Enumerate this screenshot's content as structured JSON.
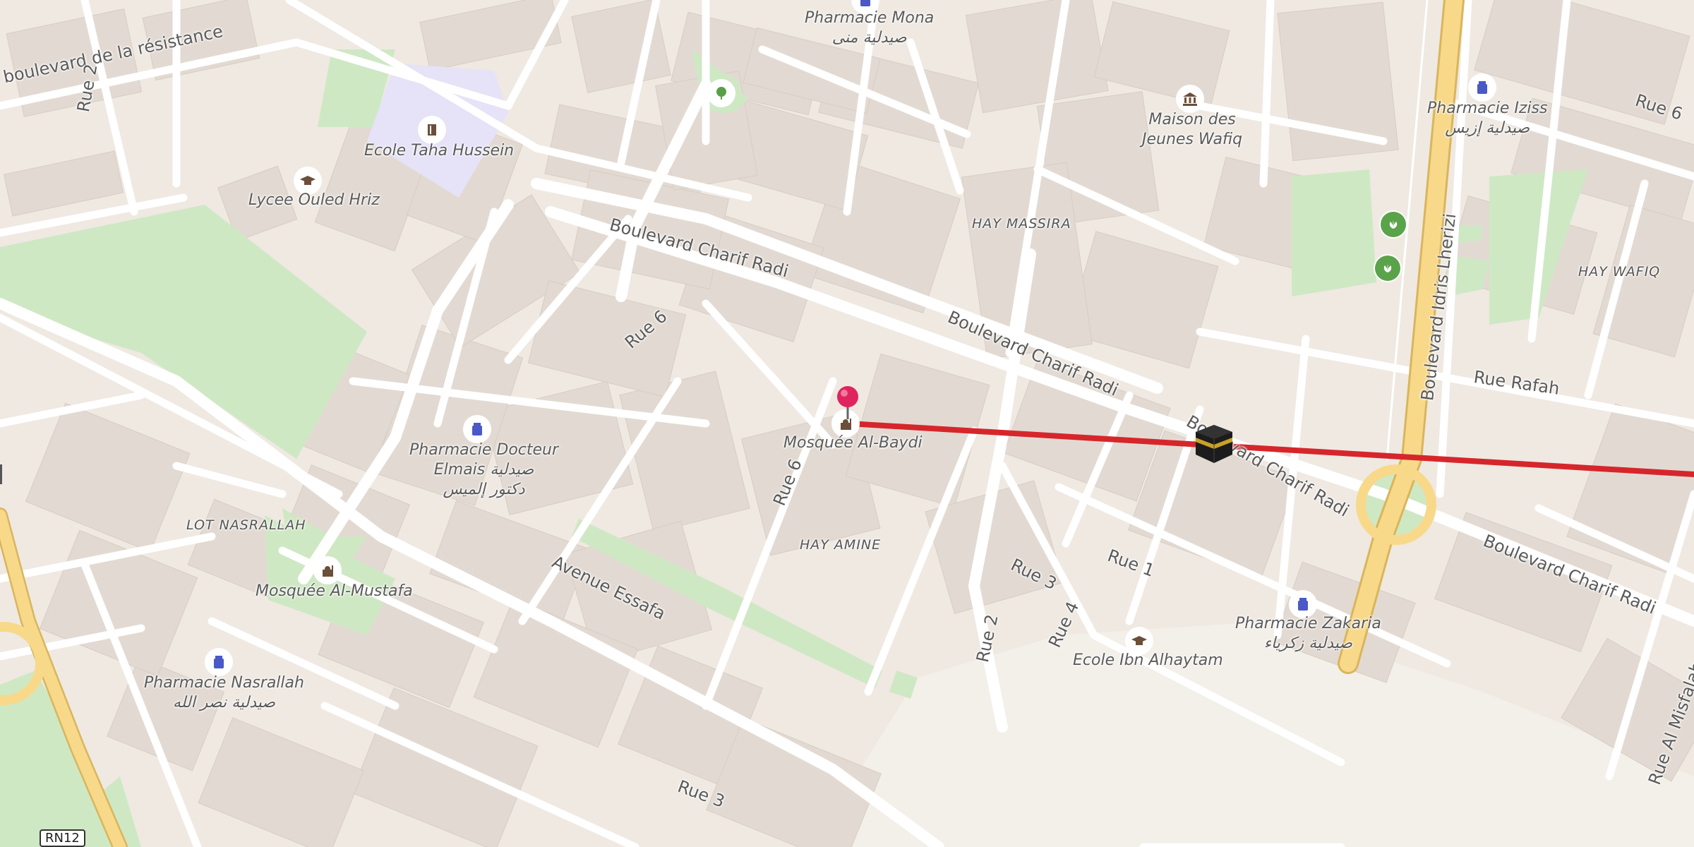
{
  "colors": {
    "land": "#efe9e2",
    "block": "#e2dad2",
    "road": "#ffffff",
    "major_road": "#f8d98a",
    "green": "#cfe8c4",
    "school": "#e6e2f7",
    "route_line": "#d6262b",
    "pin": "#e0245e",
    "pharmacy_icon": "#4a59c7",
    "amenity_icon": "#6b4f3a"
  },
  "areas": {
    "hay_massira": "HAY MASSIRA",
    "hay_wafiq": "HAY WAFIQ",
    "hay_amine": "HAY AMINE",
    "lot_nasrallah": "LOT NASRALLAH"
  },
  "streets": {
    "boulevard_resistance": "boulevard de la résistance",
    "rue_2_north": "Rue 2",
    "charif_radi_1": "Boulevard Charif Radi",
    "charif_radi_2": "Boulevard Charif Radi",
    "charif_radi_3": "Boulevard Charif Radi",
    "charif_radi_4": "Boulevard Charif Radi",
    "rue_6_north": "Rue 6",
    "rue_6_mid": "Rue 6",
    "rue_6_east": "Rue 6",
    "idris_lherizi": "Boulevard Idris Lherizi",
    "rue_rafah": "Rue Rafah",
    "avenue_essafa": "Avenue Essafa",
    "rue_1": "Rue 1",
    "rue_2_south": "Rue 2",
    "rue_3_a": "Rue 3",
    "rue_3_b": "Rue 3",
    "rue_4": "Rue 4",
    "rue_al_misfalah": "Rue Al Misfalah",
    "route_badge": "RN12"
  },
  "pois": {
    "pharmacie_mona": {
      "name": "Pharmacie Mona",
      "name_ar": "صيدلية منى",
      "icon": "pharmacy-icon"
    },
    "ecole_taha_hussein": {
      "name": "Ecole Taha Hussein",
      "icon": "school-icon"
    },
    "lycee_ouled_hriz": {
      "name": "Lycee Ouled Hriz",
      "icon": "graduation-cap-icon"
    },
    "maison_jeunes": {
      "name": "Maison des",
      "name2": "Jeunes Wafiq",
      "icon": "community-building-icon"
    },
    "pharmacie_iziss": {
      "name": "Pharmacie Iziss",
      "name_ar": "صيدلية إزيس",
      "icon": "pharmacy-icon"
    },
    "pharmacie_docteur_elmais": {
      "name": "Pharmacie Docteur",
      "name2": "Elmais صيدلية",
      "name_ar": "دكتور إلميس",
      "icon": "pharmacy-icon"
    },
    "mosquee_al_baydi": {
      "name": "Mosquée Al-Baydi",
      "icon": "mosque-icon"
    },
    "mosquee_al_mustafa": {
      "name": "Mosquée Al-Mustafa",
      "icon": "mosque-icon"
    },
    "pharmacie_nasrallah": {
      "name": "Pharmacie Nasrallah",
      "name_ar": "صيدلية نصر الله",
      "icon": "pharmacy-icon"
    },
    "pharmacie_zakaria": {
      "name": "Pharmacie Zakaria",
      "name_ar": "صيدلية زكرياء",
      "icon": "pharmacy-icon"
    },
    "ecole_ibn_alhaytam": {
      "name": "Ecole Ibn Alhaytam",
      "icon": "graduation-cap-icon"
    },
    "park_tree": {
      "icon": "tree-icon"
    },
    "garden_1": {
      "icon": "garden-icon"
    },
    "garden_2": {
      "icon": "garden-icon"
    }
  },
  "markers": {
    "location_pin": "location-pin-icon",
    "kaaba": "kaaba-icon"
  }
}
